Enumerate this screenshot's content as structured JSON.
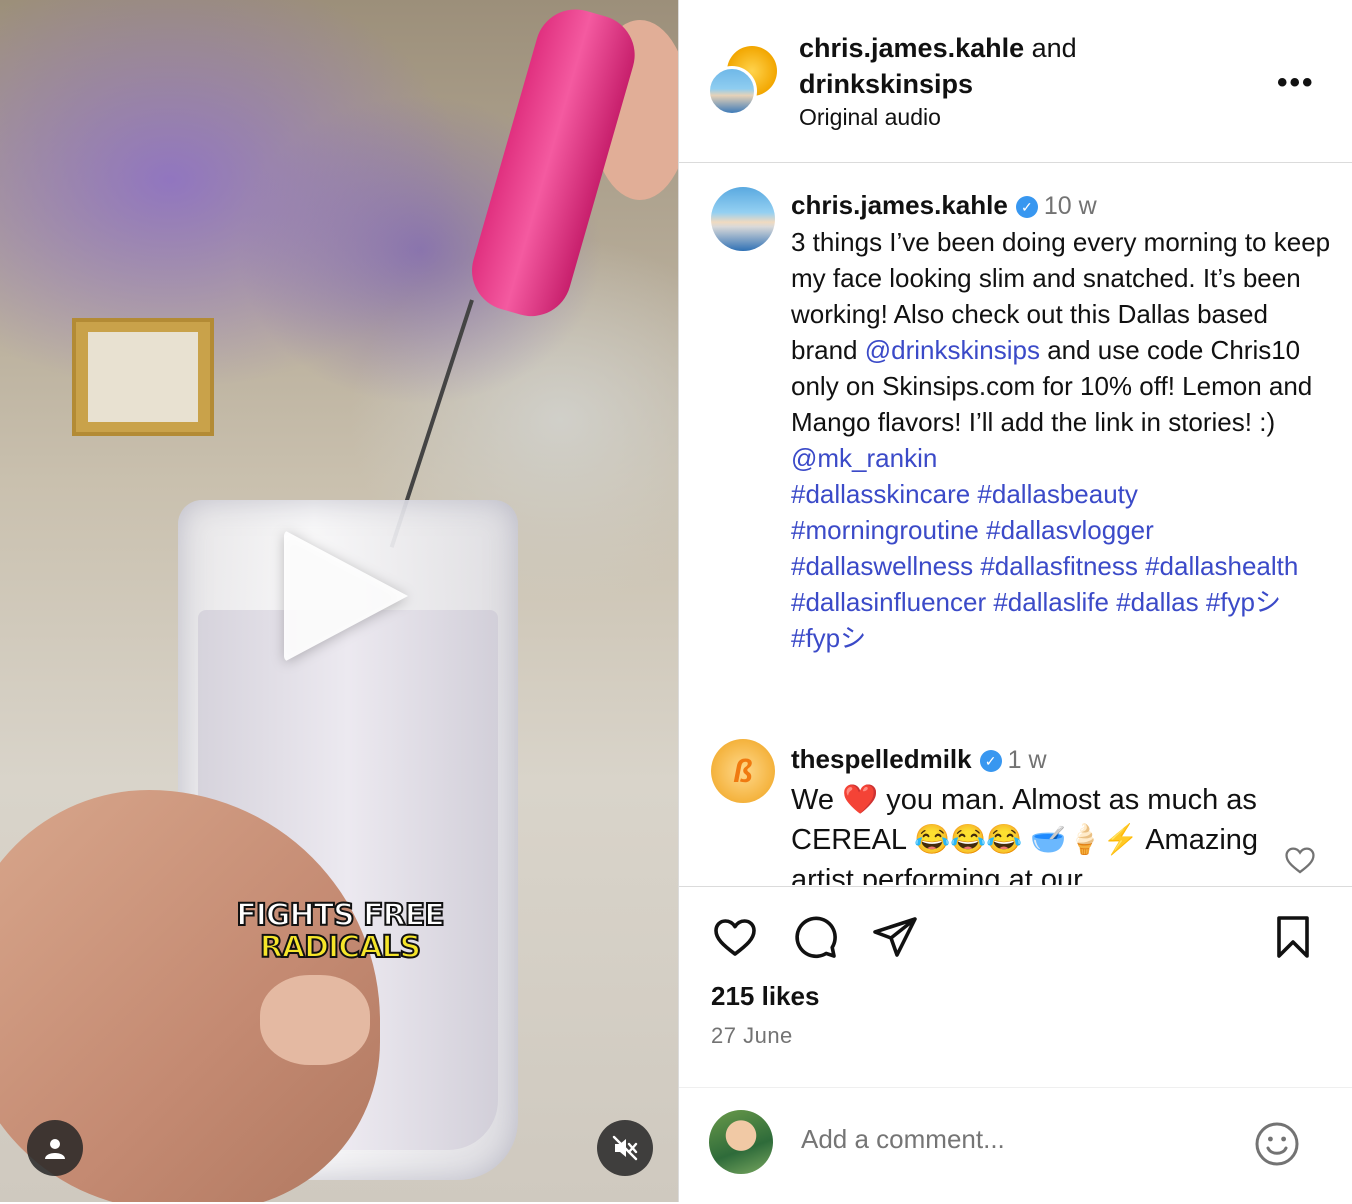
{
  "media": {
    "caption_line1": "FIGHTS FREE",
    "caption_line2": "RADICALS"
  },
  "header": {
    "user1": "chris.james.kahle",
    "joiner": " and",
    "user2": "drinkskinsips",
    "subtitle": "Original audio"
  },
  "post": {
    "username": "chris.james.kahle",
    "time": "10 w",
    "text": "3 things I’ve been doing every morning to keep my face looking slim and snatched. It’s been working! Also check out this Dallas based brand ",
    "mention1": "@drinkskinsips",
    "text2": " and use code Chris10 only on Skinsips.com for 10% off! Lemon and Mango flavors! I’ll add the link in stories! :) ",
    "mention2": "@mk_rankin",
    "hashtags": "#dallasskincare #dallasbeauty #morningroutine #dallasvlogger #dallaswellness #dallasfitness #dallashealth #dallasinfluencer #dallaslife #dallas #fypシ #fypシ"
  },
  "comment1": {
    "username": "thespelledmilk",
    "time": "1 w",
    "text": "We ❤️ you man. Almost as much as CEREAL 😂😂😂 🥣🍦⚡ Amazing artist performing at our"
  },
  "stats": {
    "likes": "215 likes",
    "date": "27 June"
  },
  "add_comment": {
    "placeholder": "Add a comment..."
  },
  "icons": {
    "accent_link": "#3b4ac8",
    "verified": "#3897f0",
    "emoji": "smile-icon"
  }
}
